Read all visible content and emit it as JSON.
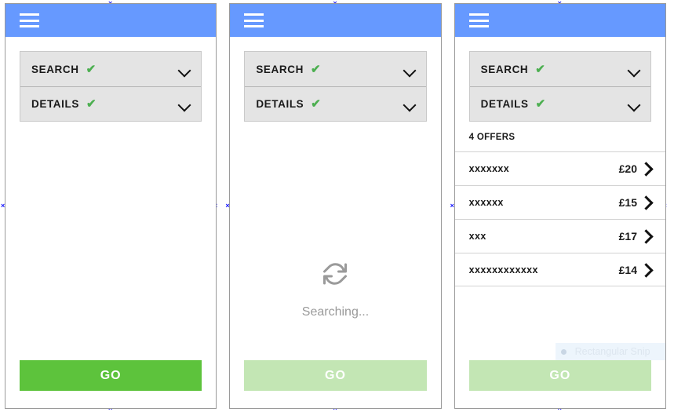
{
  "app": {
    "menu_icon": "hamburger-icon",
    "accent_blue": "#6699FF",
    "check_green": "#4CAF50",
    "go_enabled_green": "#5DC33C",
    "go_disabled_green": "#C3E6B4"
  },
  "accordion": {
    "search_label": "SEARCH",
    "details_label": "DETAILS",
    "check_glyph": "✔",
    "chevron_icon": "chevron-down-icon"
  },
  "panels": [
    {
      "state": "idle",
      "go_label": "GO",
      "go_enabled": true
    },
    {
      "state": "searching",
      "spinner_icon": "refresh-spinner-icon",
      "searching_text": "Searching...",
      "go_label": "GO",
      "go_enabled": false
    },
    {
      "state": "results",
      "offers_count_label": "4 OFFERS",
      "offers": [
        {
          "name": "xxxxxxx",
          "price": "£20",
          "chevron": "chevron-right-icon"
        },
        {
          "name": "xxxxxx",
          "price": "£15",
          "chevron": "chevron-right-icon"
        },
        {
          "name": "xxx",
          "price": "£17",
          "chevron": "chevron-right-icon"
        },
        {
          "name": "xxxxxxxxxxxx",
          "price": "£14",
          "chevron": "chevron-right-icon"
        }
      ],
      "snip_overlay": {
        "label": "Rectangular Snip",
        "icon": "snip-dot-icon"
      },
      "go_label": "GO",
      "go_enabled": false
    }
  ],
  "selection_handles": {
    "glyph": "×"
  }
}
